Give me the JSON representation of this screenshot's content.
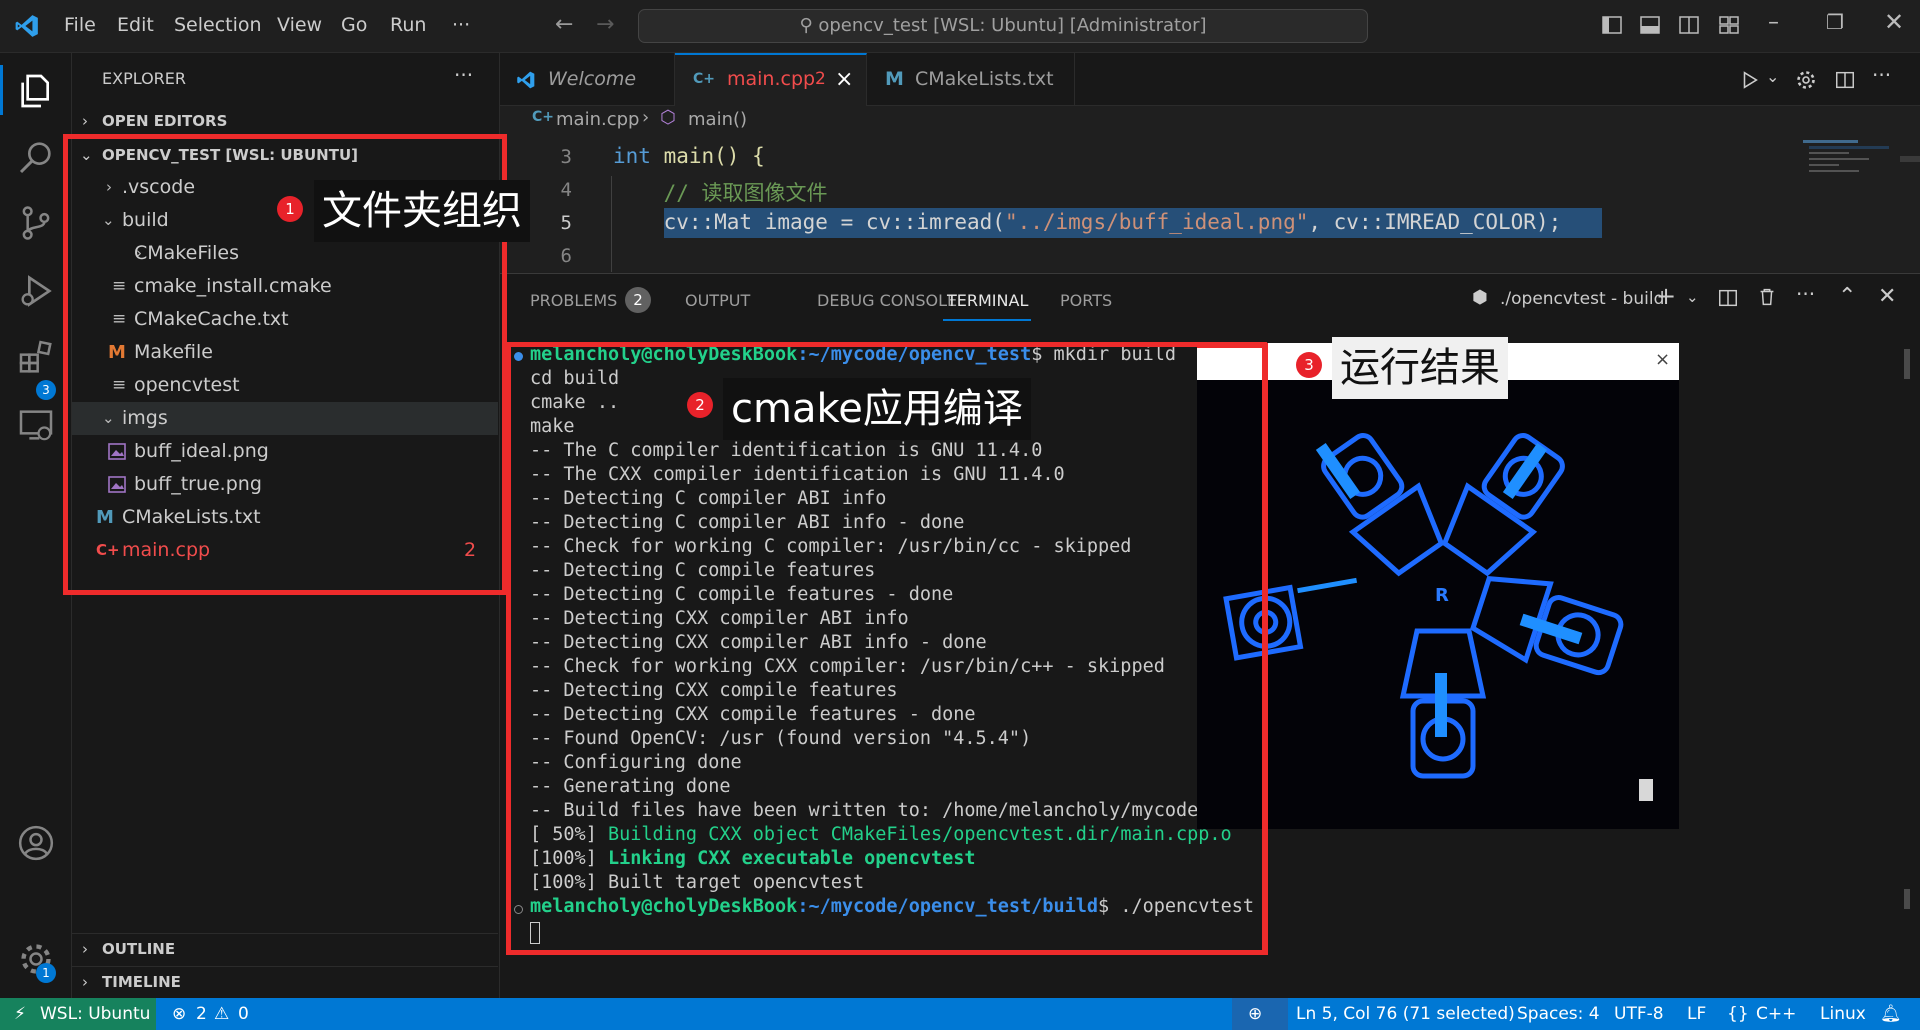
{
  "titlebar": {
    "menu": [
      "File",
      "Edit",
      "Selection",
      "View",
      "Go",
      "Run",
      "···"
    ],
    "command_center": "opencv_test [WSL: Ubuntu] [Administrator]"
  },
  "activitybar": {
    "extensions_badge": "3",
    "settings_badge": "1"
  },
  "sidebar": {
    "title": "EXPLORER",
    "more": "···",
    "open_editors": "OPEN EDITORS",
    "workspace": "OPENCV_TEST [WSL: UBUNTU]",
    "tree": [
      {
        "label": ".vscode",
        "chevron": "›"
      },
      {
        "label": "build",
        "chevron": "⌄"
      },
      {
        "label": "CMakeFiles",
        "chevron": "›"
      },
      {
        "label": "cmake_install.cmake",
        "icon": "≡"
      },
      {
        "label": "CMakeCache.txt",
        "icon": "≡"
      },
      {
        "label": "Makefile",
        "icon": "M"
      },
      {
        "label": "opencvtest",
        "icon": "≡"
      },
      {
        "label": "imgs",
        "chevron": "⌄"
      },
      {
        "label": "buff_ideal.png"
      },
      {
        "label": "buff_true.png"
      },
      {
        "label": "CMakeLists.txt",
        "icon": "M"
      },
      {
        "label": "main.cpp",
        "problems": "2"
      }
    ],
    "outline": "OUTLINE",
    "timeline": "TIMELINE"
  },
  "editor": {
    "tabs": [
      {
        "label": "Welcome"
      },
      {
        "label": "main.cpp",
        "count": "2",
        "close": "×"
      },
      {
        "label": "CMakeLists.txt"
      }
    ],
    "breadcrumb": {
      "file": "main.cpp",
      "symbol": "main()"
    },
    "lines": [
      {
        "num": "3",
        "kw": "int",
        "rest": " main() {"
      },
      {
        "num": "4",
        "comment": "    // 读取图像文件"
      },
      {
        "num": "5",
        "pre": "    cv::Mat image = cv::imread(",
        "str": "\"../imgs/buff_ideal.png\"",
        "post": ", cv::IMREAD_COLOR);"
      },
      {
        "num": "6",
        "rest": ""
      }
    ]
  },
  "panel": {
    "tabs": [
      "PROBLEMS",
      "OUTPUT",
      "DEBUG CONSOLE",
      "TERMINAL",
      "PORTS"
    ],
    "problems_count": "2",
    "terminal_name": "./opencvtest - build",
    "terminal": {
      "prompt1_user": "melancholy@cholyDeskBook",
      "prompt1_path": ":~/mycode/opencv_test",
      "prompt1_cmd": "$ mkdir build",
      "lines": [
        "cd build",
        "cmake ..",
        "make",
        "-- The C compiler identification is GNU 11.4.0",
        "-- The CXX compiler identification is GNU 11.4.0",
        "-- Detecting C compiler ABI info",
        "-- Detecting C compiler ABI info - done",
        "-- Check for working C compiler: /usr/bin/cc - skipped",
        "-- Detecting C compile features",
        "-- Detecting C compile features - done",
        "-- Detecting CXX compiler ABI info",
        "-- Detecting CXX compiler ABI info - done",
        "-- Check for working CXX compiler: /usr/bin/c++ - skipped",
        "-- Detecting CXX compile features",
        "-- Detecting CXX compile features - done",
        "-- Found OpenCV: /usr (found version \"4.5.4\")",
        "-- Configuring done",
        "-- Generating done",
        "-- Build files have been written to: /home/melancholy/mycode/"
      ],
      "build1_prefix": "[ 50%] ",
      "build1_text": "Building CXX object CMakeFiles/opencvtest.dir/main.cpp.o",
      "build2_prefix": "[100%] ",
      "build2_text": "Linking CXX executable opencvtest",
      "build3": "[100%] Built target opencvtest",
      "prompt2_user": "melancholy@cholyDeskBook",
      "prompt2_path": ":~/mycode/opencv_test/build",
      "prompt2_cmd": "$ ./opencvtest"
    }
  },
  "result_window": {
    "close": "×"
  },
  "annotations": [
    {
      "num": "1",
      "text": "文件夹组织"
    },
    {
      "num": "2",
      "text": "cmake应用编译"
    },
    {
      "num": "3",
      "text": "运行结果"
    }
  ],
  "statusbar": {
    "remote": "WSL: Ubuntu",
    "errors": "2",
    "warnings": "0",
    "position": "Ln 5, Col 76 (71 selected)",
    "spaces": "Spaces: 4",
    "encoding": "UTF-8",
    "eol": "LF",
    "language": "C++",
    "os": "Linux"
  },
  "colors": {
    "accent": "#0078d4",
    "annotation_red": "#ee2b2b",
    "terminal_green": "#23d18b",
    "prompt_blue": "#3b8eea",
    "error_red": "#f14c4c",
    "string_orange": "#ce9178",
    "keyword_blue": "#569cd6",
    "comment_green": "#6a9955"
  }
}
